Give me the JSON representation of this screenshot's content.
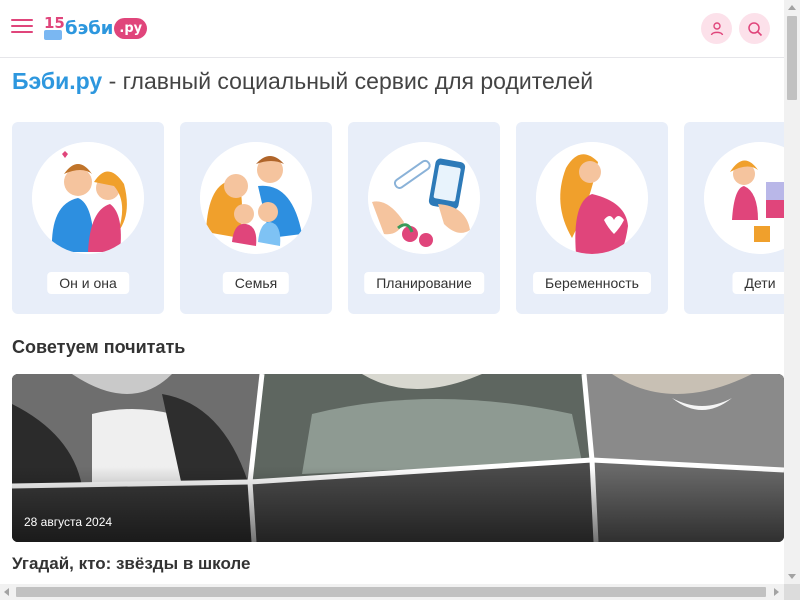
{
  "header": {
    "logo": {
      "number": "15",
      "word": "бэби",
      "suffix": ".ру"
    }
  },
  "tagline": {
    "brand": "Бэби.ру",
    "rest": " - главный социальный сервис для родителей"
  },
  "categories": [
    {
      "label": "Он и она"
    },
    {
      "label": "Семья"
    },
    {
      "label": "Планирование"
    },
    {
      "label": "Беременность"
    },
    {
      "label": "Дети"
    }
  ],
  "recommended": {
    "title": "Советуем почитать",
    "article": {
      "date": "28 августа 2024",
      "title": "Угадай, кто: звёзды в школе"
    }
  },
  "colors": {
    "accent": "#e0457b",
    "brand": "#2d97de",
    "card_bg": "#e8eef9"
  }
}
